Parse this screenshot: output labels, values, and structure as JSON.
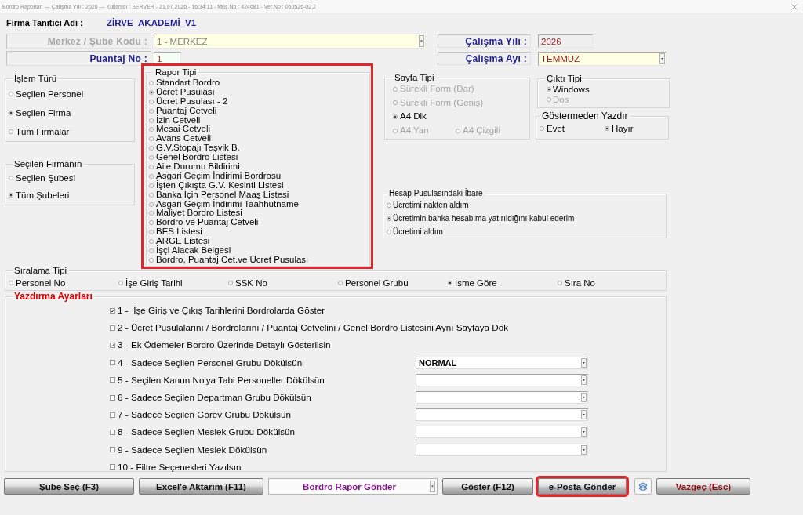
{
  "window": {
    "title": "Bordro Raporları --- Çalışma Yılı : 2026 --- Kullanıcı : SERVER - 21.07.2026 - 16:34:11 - Müş.No : 424681 - Ver.No : 060526-02.2"
  },
  "firm": {
    "label": "Firma Tanıtıcı Adı :",
    "value": "ZİRVE_AKADEMİ_V1"
  },
  "fields": [
    {
      "label": "Merkez / Şube Kodu :",
      "value": "1 - MERKEZ",
      "kind": "combo",
      "disabled": true,
      "readonly": false
    },
    {
      "label": "Çalışma Yılı :",
      "value": "2026",
      "kind": "text",
      "disabled": false,
      "readonly": true
    },
    {
      "label": "Puantaj No :",
      "value": "1",
      "kind": "text",
      "disabled": false,
      "readonly": false
    },
    {
      "label": "Çalışma Ayı :",
      "value": "TEMMUZ",
      "kind": "combo",
      "disabled": false,
      "readonly": false
    }
  ],
  "islem_turu": {
    "title": "İşlem Türü",
    "options": [
      {
        "label": "Seçilen Personel",
        "selected": false
      },
      {
        "label": "Seçilen Firma",
        "selected": true
      },
      {
        "label": "Tüm Firmalar",
        "selected": false
      }
    ]
  },
  "secilen_firmanin": {
    "title": "Seçilen Firmanın",
    "options": [
      {
        "label": "Seçilen Şubesi",
        "selected": false
      },
      {
        "label": "Tüm Şubeleri",
        "selected": true
      }
    ]
  },
  "rapor_tipi": {
    "title": "Rapor Tipi",
    "highlighted": true,
    "options": [
      {
        "label": "Standart Bordro",
        "selected": false
      },
      {
        "label": "Ücret Pusulası",
        "selected": true
      },
      {
        "label": "Ücret Pusulası - 2",
        "selected": false
      },
      {
        "label": "Puantaj Cetveli",
        "selected": false
      },
      {
        "label": "İzin Cetveli",
        "selected": false
      },
      {
        "label": "Mesai Cetveli",
        "selected": false
      },
      {
        "label": "Avans Cetveli",
        "selected": false
      },
      {
        "label": "G.V.Stopajı Teşvik B.",
        "selected": false
      },
      {
        "label": "Genel Bordro Listesi",
        "selected": false
      },
      {
        "label": "Aile Durumu Bildirimi",
        "selected": false
      },
      {
        "label": "Asgari Geçim İndirimi Bordrosu",
        "selected": false
      },
      {
        "label": "İşten Çıkışta G.V. Kesinti Listesi",
        "selected": false
      },
      {
        "label": "Banka İçin Personel Maaş Listesi",
        "selected": false
      },
      {
        "label": "Asgari Geçim İndirimi Taahhütname",
        "selected": false
      },
      {
        "label": "Maliyet Bordro Listesi",
        "selected": false
      },
      {
        "label": "Bordro ve Puantaj Cetveli",
        "selected": false
      },
      {
        "label": "BES Listesi",
        "selected": false
      },
      {
        "label": "ARGE Listesi",
        "selected": false
      },
      {
        "label": "İşçi Alacak Belgesi",
        "selected": false
      },
      {
        "label": "Bordro, Puantaj Cet.ve Ücret Pusulası",
        "selected": false
      }
    ]
  },
  "sayfa_tipi": {
    "title": "Sayfa Tipi",
    "options": [
      {
        "label": "Sürekli Form (Dar)",
        "selected": false,
        "disabled": true
      },
      {
        "label": "Sürekli Form (Geniş)",
        "selected": false,
        "disabled": true
      },
      {
        "label": "A4 Dik",
        "selected": true,
        "disabled": false
      },
      {
        "label": "A4 Yan",
        "selected": false,
        "disabled": true
      },
      {
        "label": "A4 Çizgili",
        "selected": false,
        "disabled": true
      }
    ]
  },
  "cikti_tipi": {
    "title": "Çıktı Tipi",
    "options": [
      {
        "label": "Windows",
        "selected": true,
        "disabled": false
      },
      {
        "label": "Dos",
        "selected": false,
        "disabled": true
      }
    ]
  },
  "gostermeden_yazdir": {
    "title": "Göstermeden Yazdır",
    "options": [
      {
        "label": "Evet",
        "selected": false
      },
      {
        "label": "Hayır",
        "selected": true
      }
    ]
  },
  "hesap_pusulasi_ibare": {
    "title": "Hesap Pusulasındaki İbare",
    "options": [
      {
        "label": "Ücretimi nakten aldım",
        "selected": false
      },
      {
        "label": "Ücretimin banka hesabıma yatırıldığını kabul ederim",
        "selected": true
      },
      {
        "label": "Ücretimi aldım",
        "selected": false
      }
    ]
  },
  "siralama_tipi": {
    "title": "Sıralama Tipi",
    "options": [
      {
        "label": "Personel No",
        "selected": false
      },
      {
        "label": "İşe Giriş Tarihi",
        "selected": false
      },
      {
        "label": "SSK No",
        "selected": false
      },
      {
        "label": "Personel Grubu",
        "selected": false
      },
      {
        "label": "İsme Göre",
        "selected": true
      },
      {
        "label": "Sıra No",
        "selected": false
      }
    ]
  },
  "yazdirma_ayarlari": {
    "title": "Yazdırma Ayarları",
    "items": [
      {
        "kind": "check",
        "label": "1 -  İşe Giriş ve Çıkış Tarihlerini Bordrolarda Göster",
        "checked": true
      },
      {
        "kind": "check",
        "label": "2 - Ücret Pusulalarını / Bordrolarını / Puantaj Cetvelini / Genel Bordro Listesini Aynı Sayfaya Dök",
        "checked": false
      },
      {
        "kind": "check",
        "label": "3 - Ek Ödemeler Bordro Üzerinde Detaylı Gösterilsin",
        "checked": true
      },
      {
        "kind": "select",
        "label": "4 - Sadece Seçilen Personel Grubu Dökülsün",
        "checked": false,
        "select_value": "NORMAL"
      },
      {
        "kind": "select",
        "label": "5 - Seçilen Kanun No'ya Tabi Personeller Dökülsün",
        "checked": false
      },
      {
        "kind": "select",
        "label": "6 - Sadece Seçilen Departman Grubu Dökülsün",
        "checked": false
      },
      {
        "kind": "select",
        "label": "7 - Sadece Seçilen Görev Grubu Dökülsün",
        "checked": false
      },
      {
        "kind": "select",
        "label": "8 - Sadece Seçilen Meslek Grubu Dökülsün",
        "checked": false
      },
      {
        "kind": "select",
        "label": "9 - Sadece Seçilen Meslek Dökülsün",
        "checked": false
      },
      {
        "kind": "check",
        "label": "10 - Filtre Seçenekleri Yazılsın",
        "checked": false
      }
    ]
  },
  "buttons": [
    {
      "kind": "button",
      "label": "Şube Seç (F3)",
      "highlighted": false
    },
    {
      "kind": "button",
      "label": "Excel'e Aktarım (F11)",
      "highlighted": false
    },
    {
      "kind": "dropdown",
      "label": "Bordro Rapor Gönder",
      "highlighted": false
    },
    {
      "kind": "button",
      "label": "Göster (F12)",
      "highlighted": false
    },
    {
      "kind": "button",
      "label": "e-Posta Gönder",
      "highlighted": true
    },
    {
      "kind": "settings",
      "highlighted": false
    },
    {
      "kind": "cancel",
      "label": "Vazgeç (Esc)",
      "highlighted": false
    }
  ]
}
